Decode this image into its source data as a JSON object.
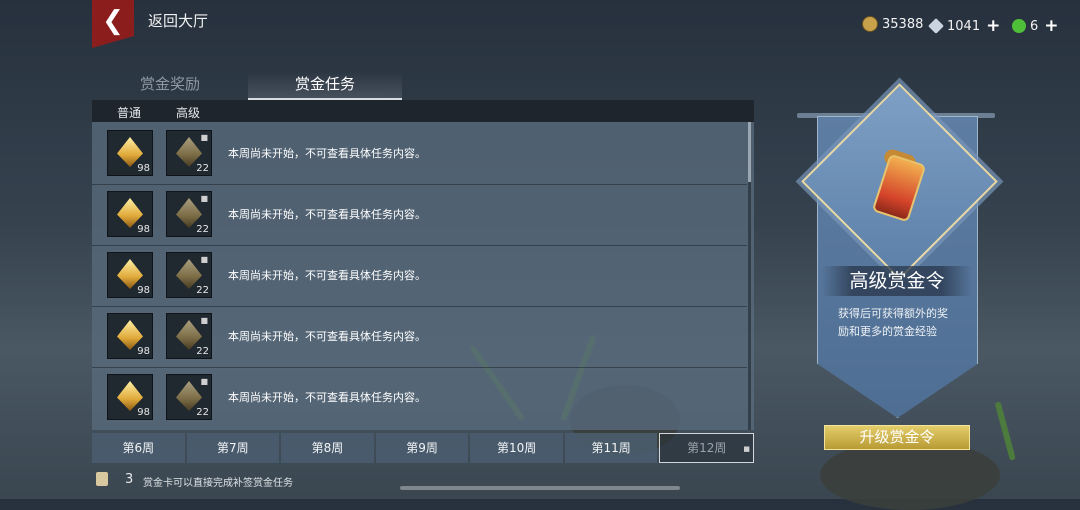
{
  "header": {
    "back_label": "返回大厅",
    "currencies": [
      {
        "name": "coin-icon",
        "value": "35388",
        "color": "#c8a24a",
        "has_plus": false
      },
      {
        "name": "diamond-icon",
        "value": "1041",
        "color": "#c9d4e0",
        "has_plus": true
      },
      {
        "name": "jade-icon",
        "value": "6",
        "color": "#4fbf3a",
        "has_plus": true
      }
    ]
  },
  "tabs": [
    {
      "label": "赏金奖励",
      "active": false
    },
    {
      "label": "赏金任务",
      "active": true
    }
  ],
  "table": {
    "col_normal": "普通",
    "col_premium": "高级",
    "rows": [
      {
        "normal_count": "98",
        "premium_count": "22",
        "text": "本周尚未开始，不可查看具体任务内容。"
      },
      {
        "normal_count": "98",
        "premium_count": "22",
        "text": "本周尚未开始，不可查看具体任务内容。"
      },
      {
        "normal_count": "98",
        "premium_count": "22",
        "text": "本周尚未开始，不可查看具体任务内容。"
      },
      {
        "normal_count": "98",
        "premium_count": "22",
        "text": "本周尚未开始，不可查看具体任务内容。"
      },
      {
        "normal_count": "98",
        "premium_count": "22",
        "text": "本周尚未开始，不可查看具体任务内容。"
      }
    ]
  },
  "weeks": [
    {
      "label": "第6周",
      "selected": false
    },
    {
      "label": "第7周",
      "selected": false
    },
    {
      "label": "第8周",
      "selected": false
    },
    {
      "label": "第9周",
      "selected": false
    },
    {
      "label": "第10周",
      "selected": false
    },
    {
      "label": "第11周",
      "selected": false
    },
    {
      "label": "第12周",
      "selected": true
    }
  ],
  "tip": {
    "count": "3",
    "text": "赏金卡可以直接完成补签赏金任务"
  },
  "premium_panel": {
    "title": "高级赏金令",
    "description": "获得后可获得额外的奖励和更多的赏金经验",
    "button_label": "升级赏金令"
  }
}
